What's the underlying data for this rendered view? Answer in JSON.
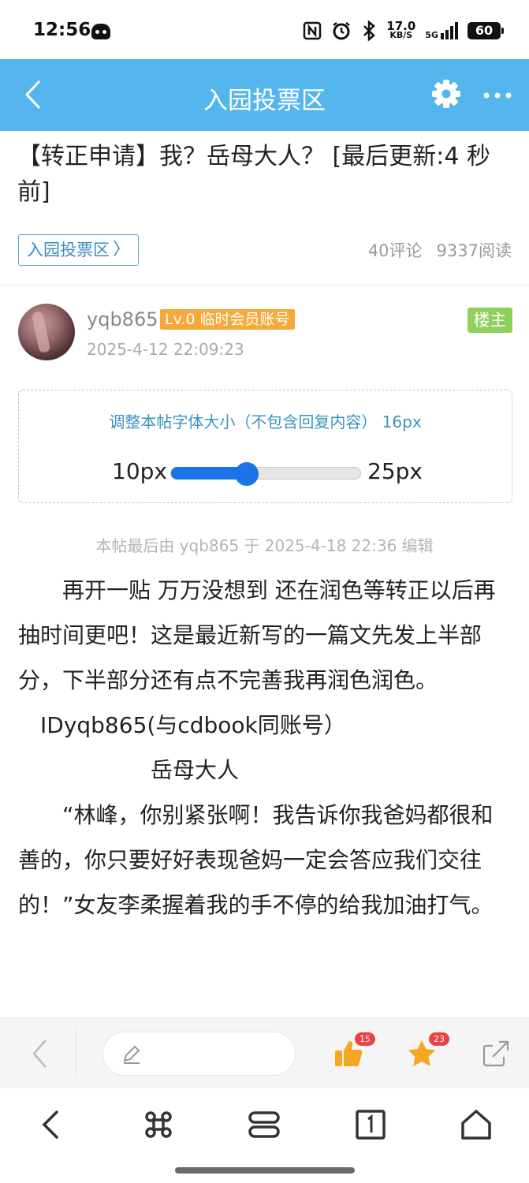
{
  "status_bar": {
    "time": "12:56",
    "net_speed_value": "17.0",
    "net_speed_unit": "KB/S",
    "network": "5G",
    "battery": "60",
    "icons": [
      "robot-app-icon",
      "nfc-icon",
      "alarm-icon",
      "bluetooth-icon",
      "signal-icon",
      "battery-icon"
    ]
  },
  "header": {
    "title": "入园投票区",
    "back_icon": "chevron-left-icon",
    "settings_icon": "gear-icon",
    "more_icon": "more-dots-icon"
  },
  "post": {
    "title": "【转正申请】我？岳母大人？ [最后更新:4 秒前]",
    "forum_tag": "入园投票区",
    "forum_tag_chevron": "〉",
    "comments": "40评论",
    "views": "9337阅读"
  },
  "author": {
    "name": "yqb865",
    "level": "Lv.0 临时会员账号",
    "op_badge": "楼主",
    "time": "2025-4-12 22:09:23"
  },
  "font_adjust": {
    "title": "调整本帖字体大小（不包含回复内容） 16px",
    "min": "10px",
    "max": "25px",
    "min_value": 10,
    "max_value": 25,
    "value": 16
  },
  "body": {
    "edit_note": "本帖最后由 yqb865 于 2025-4-18 22:36 编辑",
    "paragraphs": [
      "　　再开一贴  万万没想到  还在润色等转正以后再抽时间更吧！这是最近新写的一篇文先发上半部分，下半部分还有点不完善我再润色润色。",
      "　IDyqb865(与cdbook同账号）",
      "　　　　　　岳母大人",
      "　　“林峰，你别紧张啊！我告诉你我爸妈都很和善的，你只要好好表现爸妈一定会答应我们交往的！”女友李柔握着我的手不停的给我加油打气。"
    ]
  },
  "action_bar": {
    "like_count": "15",
    "favorite_count": "23",
    "colors": {
      "like": "#f5a623",
      "favorite": "#f5a623",
      "badge": "#e94343"
    }
  },
  "colors": {
    "header_bg": "#55b6ee",
    "level_badge": "#f4a93a",
    "op_badge": "#8ed05a",
    "slider": "#1a73e8"
  }
}
